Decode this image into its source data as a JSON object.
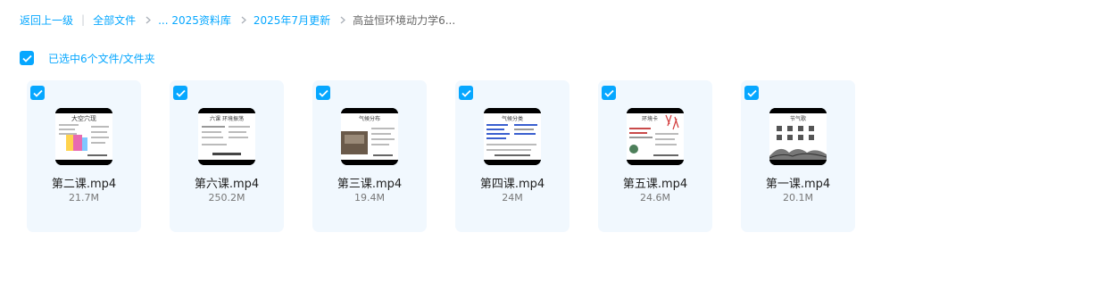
{
  "breadcrumb": {
    "back": "返回上一级",
    "separator": "|",
    "root": "全部文件",
    "ellipsis_item": "... 2025资料库",
    "month_item": "2025年7月更新",
    "current": "高益恒环境动力学6..."
  },
  "selection": {
    "label": "已选中6个文件/文件夹",
    "checked": true
  },
  "files": [
    {
      "name": "第二课.mp4",
      "size": "21.7M",
      "thumb_title": "大空穴现",
      "thumb_icon": "video-thumbnail-icon"
    },
    {
      "name": "第六课.mp4",
      "size": "250.2M",
      "thumb_title": "六课 环境振荡",
      "thumb_icon": "video-thumbnail-icon"
    },
    {
      "name": "第三课.mp4",
      "size": "19.4M",
      "thumb_title": "气候分布",
      "thumb_icon": "video-thumbnail-icon"
    },
    {
      "name": "第四课.mp4",
      "size": "24M",
      "thumb_title": "气候分类",
      "thumb_icon": "video-thumbnail-icon"
    },
    {
      "name": "第五课.mp4",
      "size": "24.6M",
      "thumb_title": "环境卡",
      "thumb_icon": "video-thumbnail-icon"
    },
    {
      "name": "第一课.mp4",
      "size": "20.1M",
      "thumb_title": "节气歌",
      "thumb_icon": "video-thumbnail-icon"
    }
  ],
  "colors": {
    "accent": "#06a7ff",
    "card_bg": "#f1f8fe",
    "muted": "#777777"
  }
}
